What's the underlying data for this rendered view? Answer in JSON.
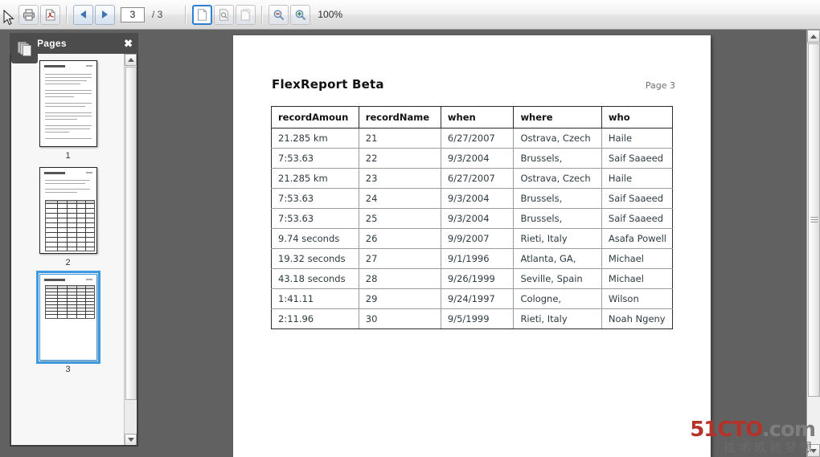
{
  "app": {
    "zoom_level": "100%"
  },
  "toolbar": {
    "print_label": "print-icon",
    "export_pdf_label": "pdf-export-icon",
    "prev_page_label": "previous-page-icon",
    "next_page_label": "next-page-icon",
    "page_number_value": "3",
    "page_total_label": "/ 3",
    "view_single_page_label": "single-page-view-icon",
    "view_page_fit_label": "page-fit-view-icon",
    "view_continuous_label": "continuous-view-icon",
    "zoom_out_label": "zoom-out-icon",
    "zoom_in_label": "zoom-in-icon",
    "zoom_value": "100%"
  },
  "sidebar": {
    "title": "Pages",
    "close_label": "✖",
    "thumbnails": [
      {
        "label": "1",
        "type": "text",
        "selected": false
      },
      {
        "label": "2",
        "type": "table",
        "selected": false
      },
      {
        "label": "3",
        "type": "table-short",
        "selected": true
      }
    ]
  },
  "document": {
    "title": "FlexReport Beta",
    "page_label": "Page 3",
    "table": {
      "columns": [
        "recordAmoun",
        "recordName",
        "when",
        "where",
        "who"
      ],
      "rows": [
        [
          "21.285 km",
          "21",
          "6/27/2007",
          "Ostrava, Czech",
          "Haile"
        ],
        [
          "7:53.63",
          "22",
          "9/3/2004",
          "Brussels,",
          "Saif Saaeed"
        ],
        [
          "21.285 km",
          "23",
          "6/27/2007",
          "Ostrava, Czech",
          "Haile"
        ],
        [
          "7:53.63",
          "24",
          "9/3/2004",
          "Brussels,",
          "Saif Saaeed"
        ],
        [
          "7:53.63",
          "25",
          "9/3/2004",
          "Brussels,",
          "Saif Saaeed"
        ],
        [
          "9.74 seconds",
          "26",
          "9/9/2007",
          "Rieti, Italy",
          "Asafa Powell"
        ],
        [
          "19.32 seconds",
          "27",
          "9/1/1996",
          "Atlanta, GA,",
          "Michael"
        ],
        [
          "43.18 seconds",
          "28",
          "9/26/1999",
          "Seville, Spain",
          "Michael"
        ],
        [
          "1:41.11",
          "29",
          "9/24/1997",
          "Cologne,",
          "Wilson"
        ],
        [
          "2:11.96",
          "30",
          "9/5/1999",
          "Rieti, Italy",
          "Noah Ngeny"
        ]
      ]
    }
  },
  "watermark": {
    "brand_red": "51CTO",
    "brand_gray": ".com",
    "tagline": "技术成就梦想",
    "red_hex": "#b53229",
    "gray_hex": "#7e7e7e"
  }
}
